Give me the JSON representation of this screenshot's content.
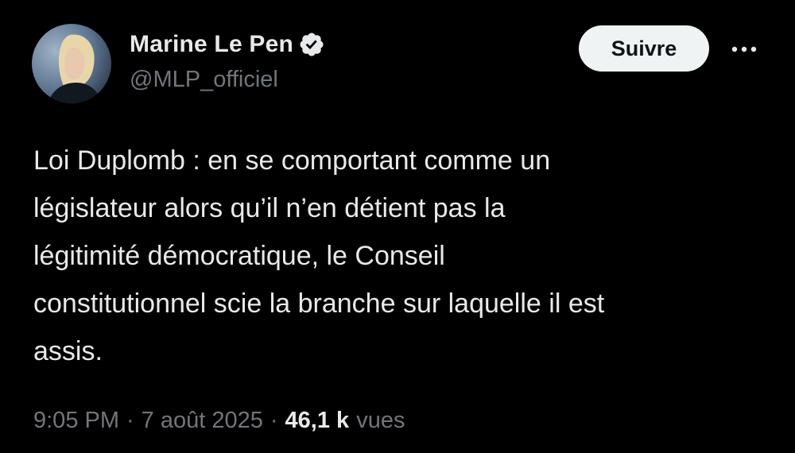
{
  "author": {
    "display_name": "Marine Le Pen",
    "handle": "@MLP_officiel",
    "verified": true,
    "verified_badge_color": "#e7e9ea"
  },
  "actions": {
    "follow_label": "Suivre",
    "more_icon": "more-horizontal-icon"
  },
  "tweet": {
    "text": "Loi Duplomb : en se comportant comme un\nlégislateur alors qu’il n’en détient pas la\nlégitimité démocratique, le Conseil\nconstitutionnel scie la branche sur laquelle il est\nassis."
  },
  "meta": {
    "time": "9:05 PM",
    "separator": "·",
    "date": "7 août 2025",
    "views_count": "46,1 k",
    "views_label": "vues"
  },
  "colors": {
    "background": "#000000",
    "primary_text": "#e7e9ea",
    "secondary_text": "#71767b",
    "follow_button_bg": "#eff3f4",
    "follow_button_text": "#0f1419"
  }
}
